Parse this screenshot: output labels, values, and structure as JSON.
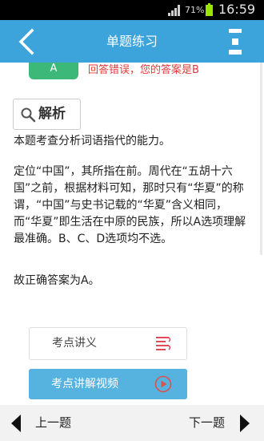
{
  "status_bar": {
    "battery_percent": "71%",
    "time": "16:59",
    "icons": [
      "signal-icon",
      "battery-icon"
    ]
  },
  "header": {
    "title": "单题练习",
    "back_icon": "chevron-left-icon",
    "menu_icon": "menu-icon",
    "background": "#3ca3db"
  },
  "answer": {
    "user_choice": "A",
    "message": "回答错误，您的答案是B",
    "badge_color": "#3cb879",
    "message_color": "#e23a3a"
  },
  "analysis": {
    "title": "解析",
    "icon": "search-icon",
    "paragraphs": [
      "本题考查分析词语指代的能力。",
      "定位“中国”，其所指在前。周代在“五胡十六国”之前，根据材料可知，那时只有“华夏”的称谓，“中国”与史书记载的“华夏”含义相同，而“华夏”即生活在中原的民族，所以A选项理解最准确。B、C、D选项均不选。",
      "故正确答案为A。"
    ]
  },
  "actions": {
    "lecture_label": "考点讲义",
    "lecture_icon": "document-icon",
    "video_label": "考点讲解视频",
    "video_icon": "play-icon"
  },
  "navigation": {
    "prev_label": "上一题",
    "next_label": "下一题"
  }
}
